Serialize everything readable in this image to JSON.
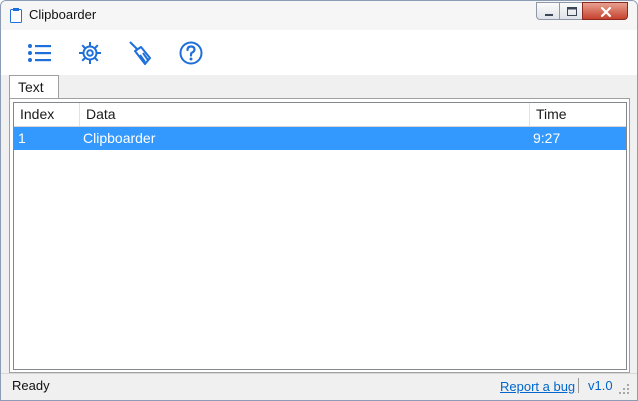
{
  "window": {
    "title": "Clipboarder",
    "controls": {
      "minimize_icon": "minimize-icon",
      "maximize_icon": "maximize-icon",
      "close_icon": "close-icon"
    }
  },
  "toolbar": {
    "buttons": [
      {
        "icon": "list-icon"
      },
      {
        "icon": "gear-icon"
      },
      {
        "icon": "broom-icon"
      },
      {
        "icon": "help-icon"
      }
    ],
    "accent_color": "#1e6fd9"
  },
  "tabs": [
    {
      "label": "Text",
      "selected": true
    }
  ],
  "table": {
    "columns": [
      "Index",
      "Data",
      "Time"
    ],
    "rows": [
      {
        "index": "1",
        "data": "Clipboarder",
        "time": "9:27",
        "selected": true
      }
    ],
    "selection_color": "#3399ff"
  },
  "status": {
    "text": "Ready",
    "report_link": "Report a bug",
    "version": "v1.0",
    "link_color": "#0066cc"
  }
}
